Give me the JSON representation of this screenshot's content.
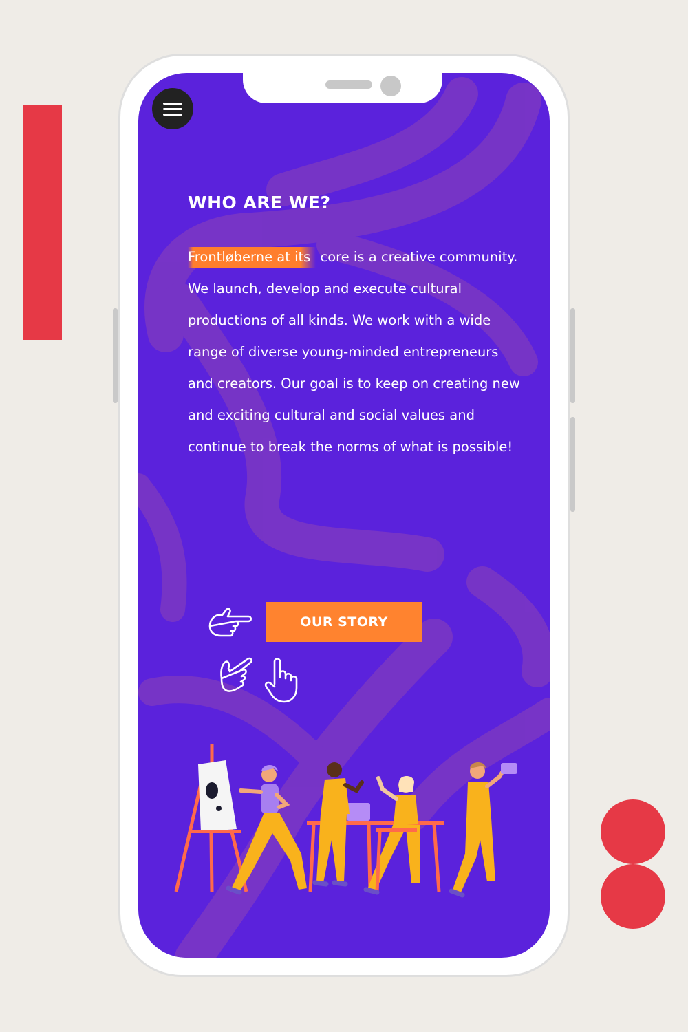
{
  "theme": {
    "page_background": "#efece7",
    "screen_background": "#5b22dc",
    "swirl_color": "#7a36c4",
    "accent": "#ff832f",
    "decor_red": "#e63946"
  },
  "content": {
    "heading": "WHO ARE WE?",
    "body_highlight": "Frontløberne at its",
    "body_text": " core is a creative community. We launch, develop and execute cultural productions of all kinds. We work with a wide range of diverse young-minded entrepreneurs and creators. Our goal is to keep on creating new and exciting cultural and social values and continue to break the norms of what is possible!",
    "cta_label": "OUR STORY"
  },
  "icons": {
    "menu": "hamburger-menu-icon",
    "hands": [
      "pointing-hand-right-icon",
      "pointing-hand-diagonal-icon",
      "tapping-hand-icon"
    ]
  }
}
